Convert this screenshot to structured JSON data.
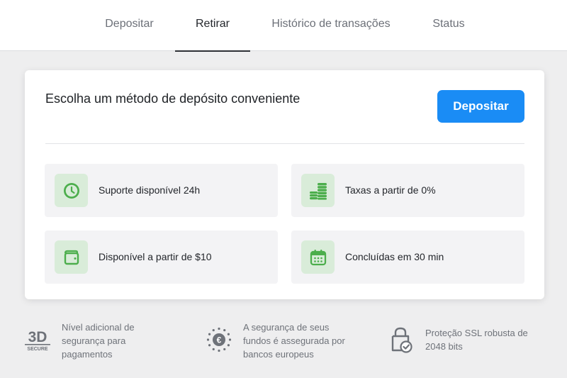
{
  "tabs": [
    {
      "label": "Depositar",
      "active": false
    },
    {
      "label": "Retirar",
      "active": true
    },
    {
      "label": "Histórico de transações",
      "active": false
    },
    {
      "label": "Status",
      "active": false
    }
  ],
  "card": {
    "title": "Escolha um método de depósito conveniente",
    "button_label": "Depositar",
    "features": [
      {
        "icon": "clock-icon",
        "label": "Suporte disponível 24h"
      },
      {
        "icon": "coins-icon",
        "label": "Taxas a partir de 0%"
      },
      {
        "icon": "wallet-icon",
        "label": "Disponível a partir de $10"
      },
      {
        "icon": "calendar-icon",
        "label": "Concluídas em 30 min"
      }
    ]
  },
  "footer": [
    {
      "icon": "3d-secure-icon",
      "icon_text": "3D",
      "icon_subtext": "SECURE",
      "lines": [
        "Nível adicional de",
        "segurança para",
        "pagamentos"
      ]
    },
    {
      "icon": "euro-stars-icon",
      "lines": [
        "A segurança de seus",
        "fundos é assegurada por",
        "bancos europeus"
      ]
    },
    {
      "icon": "lock-check-icon",
      "lines": [
        "Proteção SSL robusta de",
        "2048 bits"
      ]
    }
  ],
  "colors": {
    "accent": "#1a8cf5",
    "icon_green": "#4cae4c",
    "icon_bg": "#d9ecd9",
    "page_bg": "#eeeeef"
  }
}
